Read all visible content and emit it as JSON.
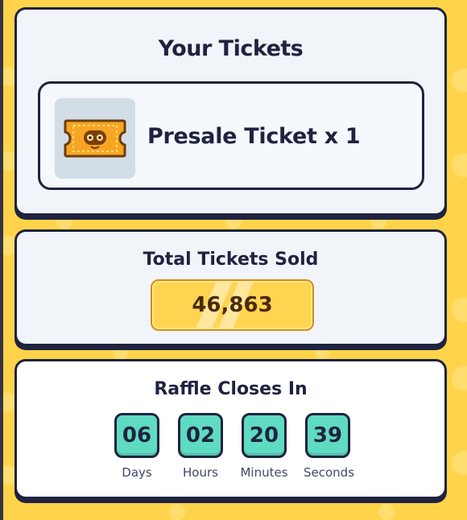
{
  "colors": {
    "background": "#ffd44a",
    "card": "#f1f5fa",
    "border": "#1f2340",
    "counter_box": "#5fdbc2",
    "sold_pill": "#ffd451"
  },
  "tickets": {
    "title": "Your Tickets",
    "item_icon": "presale-ticket-icon",
    "item_label": "Presale Ticket x 1"
  },
  "sold": {
    "title": "Total Tickets Sold",
    "value": "46,863"
  },
  "raffle": {
    "title": "Raffle Closes In",
    "countdown": [
      {
        "value": "06",
        "label": "Days"
      },
      {
        "value": "02",
        "label": "Hours"
      },
      {
        "value": "20",
        "label": "Minutes"
      },
      {
        "value": "39",
        "label": "Seconds"
      }
    ]
  }
}
